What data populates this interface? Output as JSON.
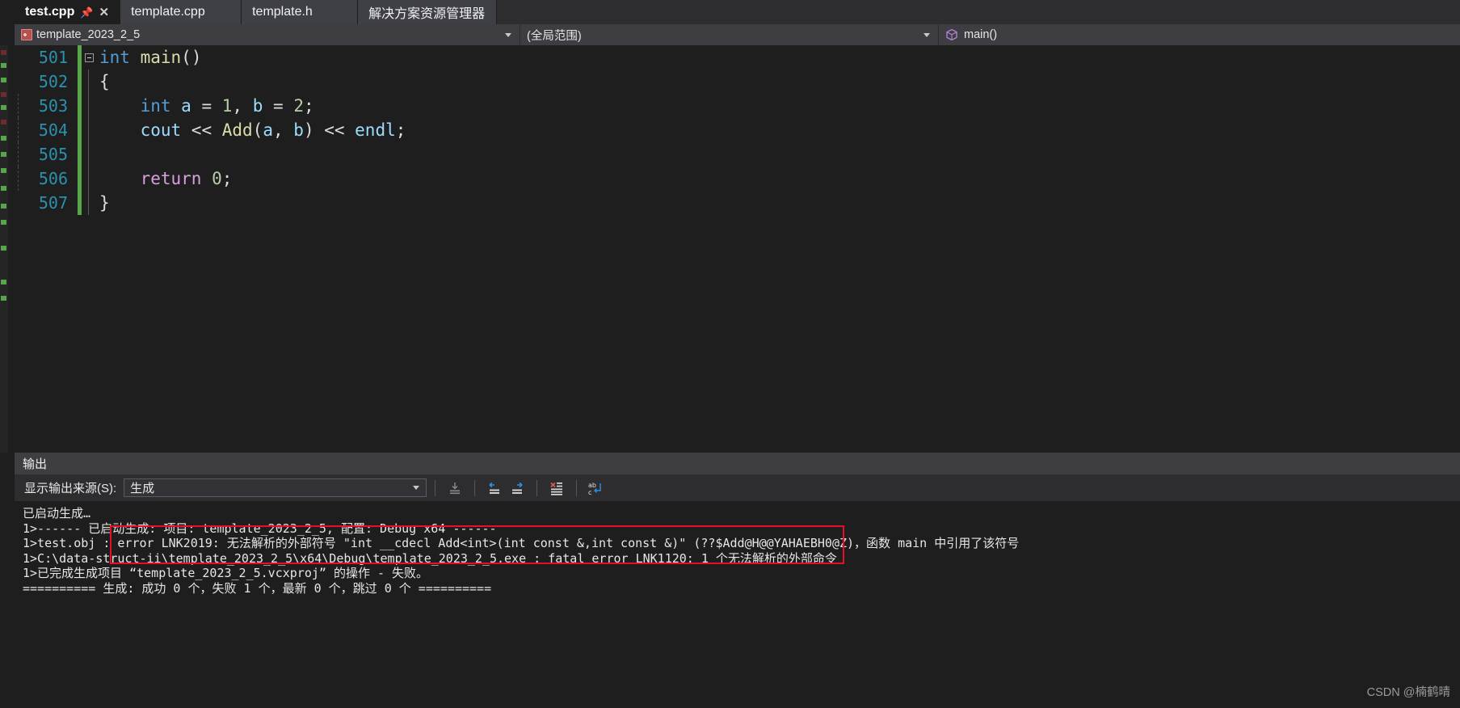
{
  "tabs": [
    {
      "label": "test.cpp",
      "active": true,
      "pin_icon": "pin-icon",
      "close_icon": "close-icon"
    },
    {
      "label": "template.cpp",
      "active": false
    },
    {
      "label": "template.h",
      "active": false
    },
    {
      "label": "解决方案资源管理器",
      "active": false
    }
  ],
  "navbar": {
    "project": "template_2023_2_5",
    "project_icon": "cpp-project-icon",
    "scope": "(全局范围)",
    "member": "main()",
    "member_icon": "method-cube-icon",
    "dropdown_icon": "chevron-down-icon"
  },
  "editor": {
    "fold_icon": "collapse-minus-icon",
    "lines": [
      {
        "no": "501",
        "tokens": [
          {
            "t": "int",
            "c": "kw"
          },
          {
            "t": " ",
            "c": "pl"
          },
          {
            "t": "main",
            "c": "fn"
          },
          {
            "t": "()",
            "c": "pl"
          }
        ],
        "fold": true,
        "indent": 0
      },
      {
        "no": "502",
        "tokens": [
          {
            "t": "{",
            "c": "pl"
          }
        ],
        "fold": false,
        "indent": 0
      },
      {
        "no": "503",
        "tokens": [
          {
            "t": "    ",
            "c": "pl"
          },
          {
            "t": "int",
            "c": "kw"
          },
          {
            "t": " ",
            "c": "pl"
          },
          {
            "t": "a",
            "c": "id"
          },
          {
            "t": " = ",
            "c": "pl"
          },
          {
            "t": "1",
            "c": "num"
          },
          {
            "t": ", ",
            "c": "pl"
          },
          {
            "t": "b",
            "c": "id"
          },
          {
            "t": " = ",
            "c": "pl"
          },
          {
            "t": "2",
            "c": "num"
          },
          {
            "t": ";",
            "c": "pl"
          }
        ],
        "fold": false,
        "indent": 1
      },
      {
        "no": "504",
        "tokens": [
          {
            "t": "    ",
            "c": "pl"
          },
          {
            "t": "cout",
            "c": "id"
          },
          {
            "t": " << ",
            "c": "pl"
          },
          {
            "t": "Add",
            "c": "fn"
          },
          {
            "t": "(",
            "c": "pl"
          },
          {
            "t": "a",
            "c": "id"
          },
          {
            "t": ", ",
            "c": "pl"
          },
          {
            "t": "b",
            "c": "id"
          },
          {
            "t": ") << ",
            "c": "pl"
          },
          {
            "t": "endl",
            "c": "id"
          },
          {
            "t": ";",
            "c": "pl"
          }
        ],
        "fold": false,
        "indent": 1
      },
      {
        "no": "505",
        "tokens": [
          {
            "t": "",
            "c": "pl"
          }
        ],
        "fold": false,
        "indent": 1
      },
      {
        "no": "506",
        "tokens": [
          {
            "t": "    ",
            "c": "pl"
          },
          {
            "t": "return",
            "c": "kw2"
          },
          {
            "t": " ",
            "c": "pl"
          },
          {
            "t": "0",
            "c": "num"
          },
          {
            "t": ";",
            "c": "pl"
          }
        ],
        "fold": false,
        "indent": 1
      },
      {
        "no": "507",
        "tokens": [
          {
            "t": "}",
            "c": "pl"
          }
        ],
        "fold": false,
        "indent": 0
      }
    ]
  },
  "output": {
    "title": "输出",
    "source_label": "显示输出来源(S):",
    "source_value": "生成",
    "toolbar_icons": [
      "jump-to-source-icon",
      "navigate-back-icon",
      "navigate-forward-icon",
      "clear-output-icon",
      "toggle-word-wrap-icon"
    ],
    "lines": [
      "已启动生成…",
      "1>------ 已启动生成: 项目: template_2023_2_5, 配置: Debug x64 ------",
      "1>test.obj : error LNK2019: 无法解析的外部符号 \"int __cdecl Add<int>(int const &,int const &)\" (??$Add@H@@YAHAEBH0@Z)，函数 main 中引用了该符号",
      "1>C:\\data-struct-ii\\template_2023_2_5\\x64\\Debug\\template_2023_2_5.exe : fatal error LNK1120: 1 个无法解析的外部命令",
      "1>已完成生成项目 “template_2023_2_5.vcxproj” 的操作 - 失败。",
      "========== 生成: 成功 0 个，失败 1 个，最新 0 个，跳过 0 个 =========="
    ]
  },
  "annotation": {
    "error_highlight_color": "#e81123"
  },
  "watermark": "CSDN @楠鹤晴"
}
